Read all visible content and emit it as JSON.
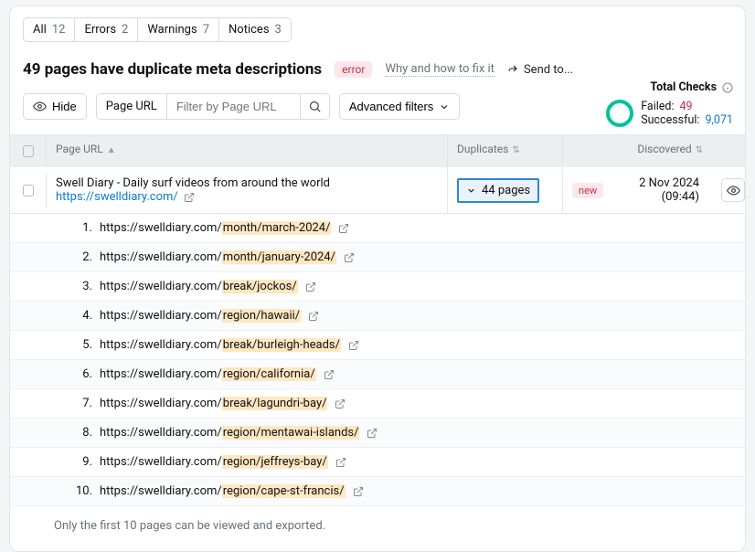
{
  "tabs": [
    {
      "label": "All",
      "count": "12"
    },
    {
      "label": "Errors",
      "count": "2"
    },
    {
      "label": "Warnings",
      "count": "7"
    },
    {
      "label": "Notices",
      "count": "3"
    }
  ],
  "heading": "49 pages have duplicate meta descriptions",
  "severity_badge": "error",
  "howto_text": "Why and how to fix it",
  "sendto_text": "Send to...",
  "hide_btn": "Hide",
  "input_prefix": "Page URL",
  "input_placeholder": "Filter by Page URL",
  "advanced_filters": "Advanced filters",
  "stats": {
    "title": "Total Checks",
    "failed_label": "Failed:",
    "failed_value": "49",
    "success_label": "Successful:",
    "success_value": "9,071"
  },
  "columns": {
    "url": "Page URL",
    "duplicates": "Duplicates",
    "discovered": "Discovered"
  },
  "main": {
    "title": "Swell Diary - Daily surf videos from around the world",
    "url": "https://swelldiary.com/",
    "duplicates": "44 pages",
    "tag": "new",
    "discovered": "2 Nov 2024 (09:44)"
  },
  "url_prefix": "https://swelldiary.com/",
  "duplicate_pages": [
    "month/march-2024/",
    "month/january-2024/",
    "break/jockos/",
    "region/hawaii/",
    "break/burleigh-heads/",
    "region/california/",
    "break/lagundri-bay/",
    "region/mentawai-islands/",
    "region/jeffreys-bay/",
    "region/cape-st-francis/"
  ],
  "note": "Only the first 10 pages can be viewed and exported."
}
